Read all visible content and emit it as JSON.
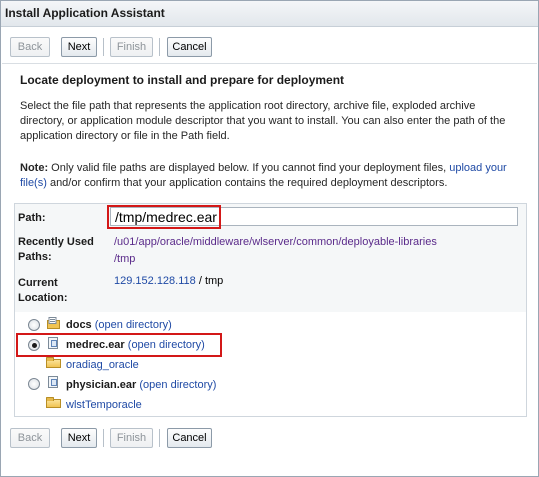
{
  "window": {
    "title": "Install Application Assistant"
  },
  "toolbar": {
    "back": "Back",
    "next": "Next",
    "finish": "Finish",
    "cancel": "Cancel"
  },
  "main": {
    "heading": "Locate deployment to install and prepare for deployment",
    "description": "Select the file path that represents the application root directory, archive file, exploded archive directory, or application module descriptor that you want to install. You can also enter the path of the application directory or file in the Path field.",
    "note_label": "Note:",
    "note_text_1": " Only valid file paths are displayed below. If you cannot find your deployment files, ",
    "note_link": "upload your file(s)",
    "note_text_2": " and/or confirm that your application contains the required deployment descriptors."
  },
  "form": {
    "path_label": "Path:",
    "path_value": "/tmp/medrec.ear",
    "recent_label_1": "Recently Used",
    "recent_label_2": "Paths:",
    "recent_paths": [
      "/u01/app/oracle/middleware/wlserver/common/deployable-libraries",
      "/tmp"
    ],
    "location_label_1": "Current",
    "location_label_2": "Location:",
    "location_host": "129.152.128.118",
    "location_sep": " / ",
    "location_dir": "tmp"
  },
  "tree": {
    "items": [
      {
        "name": "docs",
        "action": "(open directory)",
        "selected": false
      },
      {
        "name": "medrec.ear",
        "action": "(open directory)",
        "selected": true,
        "child": "oradiag_oracle"
      },
      {
        "name": "physician.ear",
        "action": "(open directory)",
        "selected": false,
        "child": "wlstTemporacle"
      }
    ]
  },
  "colors": {
    "highlight": "#d31818",
    "link": "#1f4aa5",
    "visited": "#5a2a8a"
  },
  "icons": [
    "radio-icon",
    "docs-folder-icon",
    "ear-file-icon",
    "folder-icon"
  ]
}
